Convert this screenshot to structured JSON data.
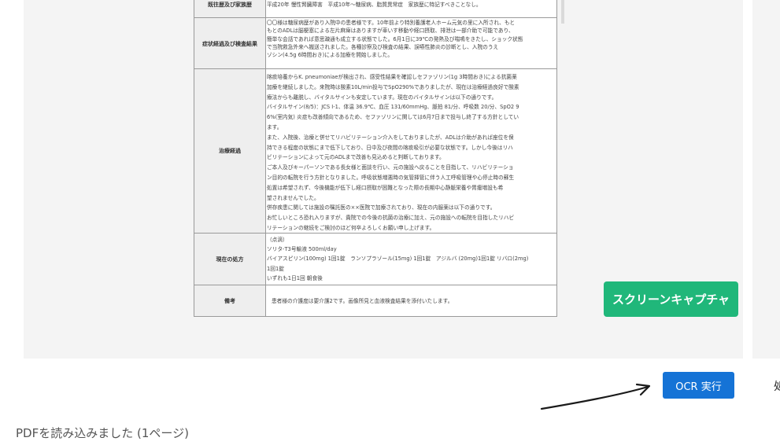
{
  "document": {
    "rows": [
      {
        "label": "既往歴及び家族歴",
        "lines": [
          "平成20年 慢性腎臓障害　平成10年～糖尿病、脂質異常症　家族歴に特記すべきことなし。"
        ]
      },
      {
        "label": "症状経過及び検査結果",
        "lines": [
          "〇〇様は糖尿病歴があり入院中の患者様です。10年前より特別養護老人ホーム元気の里に入所され、もと",
          "もとのADLは脳梗塞による左片麻痺はありますが車いす移動や経口摂取、排泄は一部介助で可能であり、",
          "簡単な会話であれば意思疎通も成立する状態でした。6月1日に39℃の発熱及び喘鳴をきたし、ショック状態",
          "で当院救急外来へ搬送されました。各種診察及び検査の結果、誤嚥性肺炎の診断とし、入院のうえ",
          "ゾシン(4.5g 6時間おき)による加療を開始しました。"
        ]
      },
      {
        "label": "治療経過",
        "lines": [
          "喀痰培養からK. pneumoniaeが検出され、感受性結果を確認しセファゾリン(1g 3時間おき)による抗菌薬",
          "加療を継続しました。来院時は酸素10L/min投与でSpO290%でありましたが、現在は治療経過良好で酸素",
          "療法からも離脱し、バイタルサインも安定しています。現在のバイタルサインは以下の通りです。",
          "バイタルサイン(8/5)：JCS Ⅰ-1、体温 36.9℃、血圧 131/60mmHg、脈拍 81/分、呼吸数 20/分、SpO2 9",
          "6%(室内気) 炎症も改善傾向であるため、セファゾリンに関しては6月7日まで投与し終了する方針としてい",
          "ます。",
          "また、入院後、治療と併せてリハビリテーション介入をしておりましたが、ADLは介助があれば座位を保",
          "持できる程度の状態にまで低下しており、日中及び夜間の喀痰吸引が必要な状態です。しかし今後はリハ",
          "ビリテーションによって元のADLまで改善も見込めると判断しております。",
          "ご本人及びキーパーソンである長女様と面談を行い、元の施設へ戻ることを目指して、リハビリテーショ",
          "ン目的の転院を行う方針となりました。呼吸状態増悪時の気管挿管に伴う人工呼吸管理や心停止時の蘇生",
          "処置は希望されず、今後機能が低下し経口摂取が困難となった際の長期中心静脈栄養や胃瘻増設も希",
          "望されませんでした。",
          "併存疾患に関しては施設の嘱託医の××医院で加療されており、現在の内服薬は以下の通りです。",
          "お忙しいところ恐れ入りますが、貴院での今後の抗菌の治療に加え、元の施設への転院を目指したリハビ",
          "リテーションの継続をご検討のほど何卒よろしくお願い申し上げます。"
        ]
      },
      {
        "label": "現在の処方",
        "lines": [
          "（点滴）",
          "ソリタ-T3号輸液 500ml/day",
          "バイアスピリン(100mg) 1回1錠　ランソプラゾール(15mg) 1回1錠　アジルバ (20mg)1回1錠 リバロ(2mg)",
          "1回1錠",
          "いずれも1日1回 朝食後"
        ]
      },
      {
        "label": "備考",
        "lines": [
          "患者様の介護度は要介護2です。画像所見と血液検査結果を添付いたします。"
        ]
      }
    ]
  },
  "buttons": {
    "capture_label": "スクリーンキャプチャ",
    "ocr_label": "OCR 実行"
  },
  "edge_text": "処",
  "status_text": "PDFを読み込みました (1ページ)"
}
